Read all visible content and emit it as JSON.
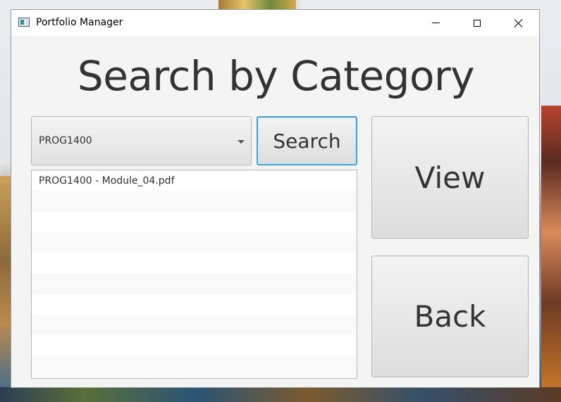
{
  "window": {
    "title": "Portfolio Manager"
  },
  "main": {
    "heading": "Search by Category"
  },
  "category_select": {
    "selected": "PROG1400"
  },
  "buttons": {
    "search": "Search",
    "view": "View",
    "back": "Back"
  },
  "results": {
    "items": [
      "PROG1400 - Module_04.pdf"
    ]
  },
  "colors": {
    "focus_border": "#3fa3dc",
    "window_bg": "#f4f4f4"
  }
}
